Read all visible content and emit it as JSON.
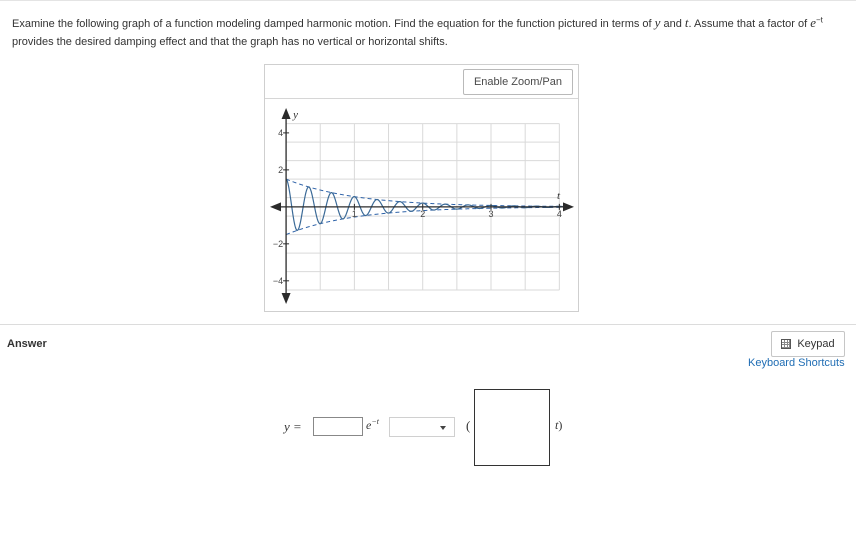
{
  "question": {
    "text_a": "Examine the following graph of a function modeling damped harmonic motion. Find the equation for the function pictured in terms of ",
    "var_y": "y",
    "text_and": " and ",
    "var_t": "t",
    "text_b": ". Assume that a factor of ",
    "factor_base": "e",
    "factor_exp": "−t",
    "text_c": "provides the desired damping effect and that the graph has no vertical or horizontal shifts."
  },
  "graph": {
    "zoom_button_label": "Enable Zoom/Pan",
    "y_axis_label": "y",
    "x_axis_label": "t",
    "y_ticks": [
      {
        "value": 4,
        "label": "4"
      },
      {
        "value": 2,
        "label": "2"
      },
      {
        "value": -2,
        "label": "−2"
      },
      {
        "value": -4,
        "label": "−4"
      }
    ],
    "x_ticks": [
      {
        "value": 1,
        "label": "1"
      },
      {
        "value": 2,
        "label": "2"
      },
      {
        "value": 3,
        "label": "3"
      },
      {
        "value": 4,
        "label": "4"
      }
    ],
    "x_range": [
      -0.25,
      4.2
    ],
    "y_range": [
      -5.2,
      5.4
    ],
    "grid_step_x": 0.5,
    "grid_step_y": 1,
    "envelope_amplitude": 1.5,
    "oscillations_per_unit": 3,
    "curve_color": "#3b6a97",
    "envelope_color": "#2e62a8",
    "axis_color": "#2b2b2b",
    "grid_color": "#d9d9d9"
  },
  "answer": {
    "label": "Answer",
    "keypad_label": "Keypad",
    "keypad_icon": "calculator-icon",
    "shortcuts_label": "Keyboard Shortcuts",
    "eq_lhs": "y",
    "eq_sign": "=",
    "exp_base": "e",
    "exp_power": "−t",
    "paren_open": "(",
    "paren_close_var": "t",
    "paren_close": ")",
    "coefficient_value": "",
    "function_selected": "",
    "argument_value": ""
  }
}
